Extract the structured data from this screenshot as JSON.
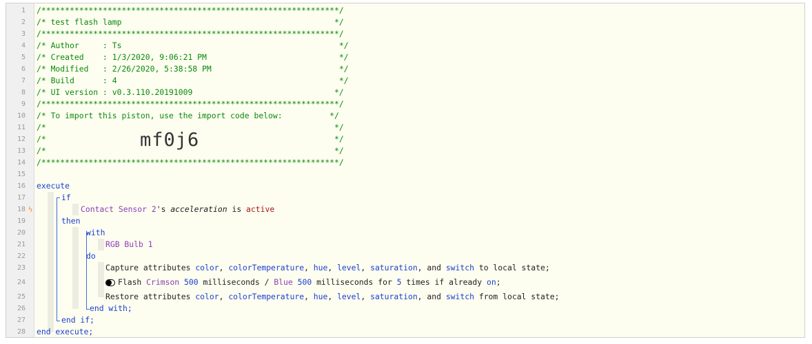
{
  "header": {
    "border": "/***************************************************************/",
    "title_line": "/* test flash lamp                                             */",
    "author_line": "/* Author     : Ts                                              */",
    "created_line": "/* Created    : 1/3/2020, 9:06:21 PM                            */",
    "modified_line": "/* Modified   : 2/26/2020, 5:38:58 PM                           */",
    "build_line": "/* Build      : 4                                               */",
    "ui_line": "/* UI version : v0.3.110.20191009                              */",
    "import_line": "/* To import this piston, use the import code below:          */",
    "empty_line": "/*                                                             */",
    "import_code": "mf0j6"
  },
  "line_numbers": [
    "1",
    "2",
    "3",
    "4",
    "5",
    "6",
    "7",
    "8",
    "9",
    "10",
    "11",
    "12",
    "13",
    "14",
    "15",
    "16",
    "17",
    "18",
    "19",
    "20",
    "21",
    "22",
    "23",
    "24",
    "25",
    "26",
    "27",
    "28"
  ],
  "code": {
    "execute": "execute",
    "if": "if",
    "device1": "Contact Sensor 2",
    "possessive": "'s ",
    "attribute": "acceleration",
    "is": " is ",
    "state": "active",
    "then": "then",
    "with": "with",
    "device2": "RGB Bulb 1",
    "do": "do",
    "capture_pre": "Capture attributes ",
    "restore_pre": "Restore attributes ",
    "a_color": "color",
    "a_colortemp": "colorTemperature",
    "a_hue": "hue",
    "a_level": "level",
    "a_saturation": "saturation",
    "a_switch": "switch",
    "comma": ", ",
    "and": ", and ",
    "capture_post": " to local state;",
    "restore_post": " from local state;",
    "flash_pre": "Flash ",
    "flash_color1": "Crimson",
    "flash_ms1": "500",
    "flash_mid": " milliseconds / ",
    "flash_color2": "Blue",
    "flash_ms2": "500",
    "flash_mid2": " milliseconds for ",
    "flash_times": "5",
    "flash_post1": " times if already ",
    "flash_on": "on",
    "semicolon": ";",
    "space": " ",
    "end_with": "end with;",
    "end_if": "end if;",
    "end_execute": "end execute;"
  },
  "colors": {
    "comment": "#0a8a0a",
    "keyword": "#1a3fcf",
    "device": "#8a3fb8",
    "value": "#a01818",
    "bolt": "#ff8a2a"
  },
  "icons": {
    "trigger": "lightning-bolt-icon",
    "toggle": "toggle-switch-icon"
  }
}
